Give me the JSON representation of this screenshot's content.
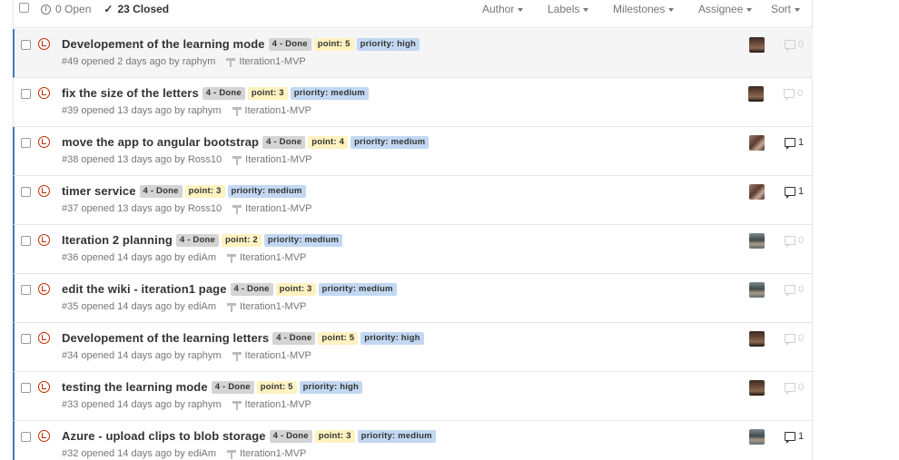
{
  "header": {
    "open_label": "0 Open",
    "closed_label": "23 Closed",
    "filters": [
      {
        "label": "Author"
      },
      {
        "label": "Labels"
      },
      {
        "label": "Milestones"
      },
      {
        "label": "Assignee"
      },
      {
        "label": "Sort"
      }
    ]
  },
  "issues": [
    {
      "title": "Developement of the learning mode",
      "status_label": "4 - Done",
      "point": "point: 5",
      "priority": "priority: high",
      "meta": "#49 opened 2 days ago by raphym",
      "milestone": "Iteration1-MVP",
      "comments": "0",
      "avatar": "raphym"
    },
    {
      "title": "fix the size of the letters",
      "status_label": "4 - Done",
      "point": "point: 3",
      "priority": "priority: medium",
      "meta": "#39 opened 13 days ago by raphym",
      "milestone": "Iteration1-MVP",
      "comments": "0",
      "avatar": "raphym"
    },
    {
      "title": "move the app to angular bootstrap",
      "status_label": "4 - Done",
      "point": "point: 4",
      "priority": "priority: medium",
      "meta": "#38 opened 13 days ago by Ross10",
      "milestone": "Iteration1-MVP",
      "comments": "1",
      "avatar": "Ross10"
    },
    {
      "title": "timer service",
      "status_label": "4 - Done",
      "point": "point: 3",
      "priority": "priority: medium",
      "meta": "#37 opened 13 days ago by Ross10",
      "milestone": "Iteration1-MVP",
      "comments": "1",
      "avatar": "Ross10"
    },
    {
      "title": "Iteration 2 planning",
      "status_label": "4 - Done",
      "point": "point: 2",
      "priority": "priority: medium",
      "meta": "#36 opened 14 days ago by ediAm",
      "milestone": "Iteration1-MVP",
      "comments": "0",
      "avatar": "ediAm"
    },
    {
      "title": "edit the wiki - iteration1 page",
      "status_label": "4 - Done",
      "point": "point: 3",
      "priority": "priority: medium",
      "meta": "#35 opened 14 days ago by ediAm",
      "milestone": "Iteration1-MVP",
      "comments": "0",
      "avatar": "ediAm"
    },
    {
      "title": "Developement of the learning letters",
      "status_label": "4 - Done",
      "point": "point: 5",
      "priority": "priority: high",
      "meta": "#34 opened 14 days ago by raphym",
      "milestone": "Iteration1-MVP",
      "comments": "0",
      "avatar": "raphym"
    },
    {
      "title": "testing the learning mode",
      "status_label": "4 - Done",
      "point": "point: 5",
      "priority": "priority: high",
      "meta": "#33 opened 14 days ago by raphym",
      "milestone": "Iteration1-MVP",
      "comments": "0",
      "avatar": "raphym"
    },
    {
      "title": "Azure - upload clips to blob storage",
      "status_label": "4 - Done",
      "point": "point: 3",
      "priority": "priority: medium",
      "meta": "#32 opened 14 days ago by ediAm",
      "milestone": "Iteration1-MVP",
      "comments": "1",
      "avatar": "ediAm"
    }
  ],
  "colors": {
    "closed_icon": "#bd2c00",
    "unread_bar": "#4078c0",
    "label_done": "#d4d4d4",
    "label_point": "#fef2c0",
    "label_priority": "#c2d8f2"
  }
}
